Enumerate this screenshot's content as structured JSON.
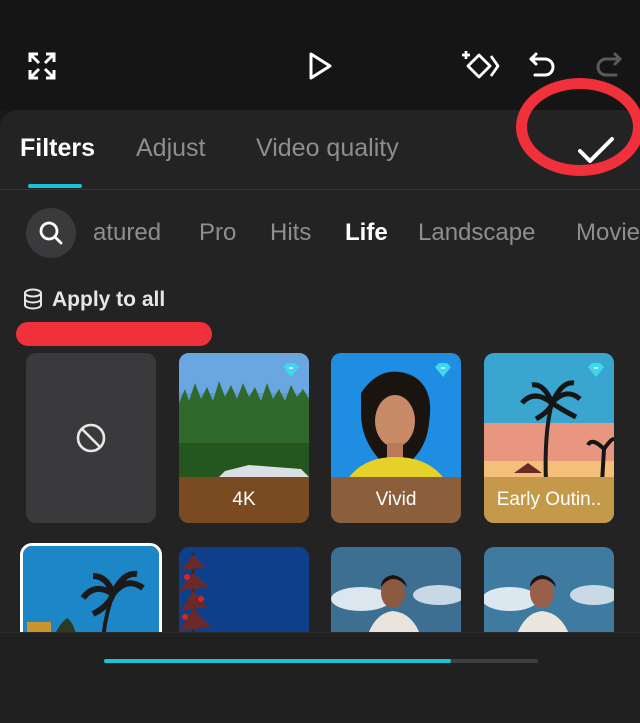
{
  "toolbar": {
    "icons": [
      "fullscreen-icon",
      "play-icon",
      "add-keyframe-icon",
      "undo-icon",
      "redo-icon"
    ]
  },
  "tabs": [
    {
      "label": "Filters",
      "active": true
    },
    {
      "label": "Adjust",
      "active": false
    },
    {
      "label": "Video quality",
      "active": false
    }
  ],
  "confirm": {
    "icon": "checkmark-icon"
  },
  "categories": [
    {
      "label": "atured",
      "active": false
    },
    {
      "label": "Pro",
      "active": false
    },
    {
      "label": "Hits",
      "active": false
    },
    {
      "label": "Life",
      "active": true
    },
    {
      "label": "Landscape",
      "active": false
    },
    {
      "label": "Movie",
      "active": false
    }
  ],
  "apply_all": {
    "label": "Apply to all",
    "icon": "stack-icon"
  },
  "filters": [
    {
      "label": "",
      "icon": "no-filter-icon"
    },
    {
      "label": "4K",
      "premium": true
    },
    {
      "label": "Vivid",
      "premium": true
    },
    {
      "label": "Early Outin..",
      "premium": true
    }
  ],
  "progress": {
    "value": 0.8
  },
  "colors": {
    "accent": "#19c4d6",
    "annotation_red": "#f0303a",
    "sheet_bg": "#232323"
  }
}
